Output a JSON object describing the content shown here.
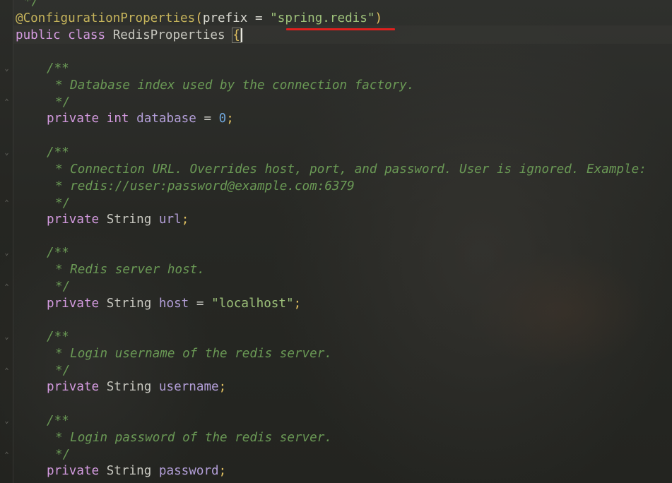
{
  "editor": {
    "top_comment_end": "*/",
    "annotation": "@ConfigurationProperties",
    "prefix_attr": "prefix",
    "equals": " = ",
    "prefix_value": "\"spring.redis\"",
    "class_decl_kw1": "public",
    "class_decl_kw2": "class",
    "class_name": "RedisProperties",
    "open_brace": "{",
    "comment_open": "/**",
    "comment_close": "*/",
    "fields": [
      {
        "doc": [
          "* Database index used by the connection factory."
        ],
        "modifier": "private",
        "type": "int",
        "name": "database",
        "initializer": "0"
      },
      {
        "doc": [
          "* Connection URL. Overrides host, port, and password. User is ignored. Example:",
          "* redis://user:password@example.com:6379"
        ],
        "modifier": "private",
        "type": "String",
        "name": "url",
        "initializer": ""
      },
      {
        "doc": [
          "* Redis server host."
        ],
        "modifier": "private",
        "type": "String",
        "name": "host",
        "initializer": "\"localhost\""
      },
      {
        "doc": [
          "* Login username of the redis server."
        ],
        "modifier": "private",
        "type": "String",
        "name": "username",
        "initializer": ""
      },
      {
        "doc": [
          "* Login password of the redis server."
        ],
        "modifier": "private",
        "type": "String",
        "name": "password",
        "initializer": ""
      }
    ]
  },
  "highlight": {
    "underline_color": "#e0201e"
  }
}
